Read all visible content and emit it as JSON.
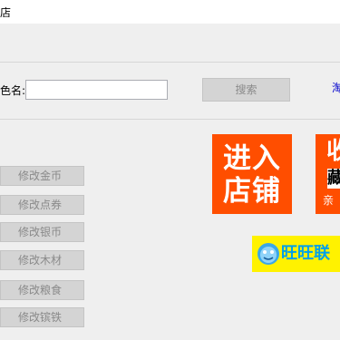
{
  "window": {
    "title": "店"
  },
  "search": {
    "label": "色名:",
    "input_value": "",
    "button_label": "搜索",
    "link_label": "淘"
  },
  "modify_buttons": [
    {
      "label": "修改金币"
    },
    {
      "label": "修改点券"
    },
    {
      "label": "修改银币"
    },
    {
      "label": "修改木材"
    },
    {
      "label": "修改粮食"
    },
    {
      "label": "修改镔铁"
    }
  ],
  "banners": {
    "enter_store": {
      "line1": "进入",
      "line2": "店铺",
      "color": "#ff4e00"
    },
    "favorite": {
      "char1": "收",
      "char2": "藏",
      "char3": "亲",
      "color": "#ff4e00"
    },
    "wangwang": {
      "label": "旺旺联",
      "bg_color": "#fff200",
      "text_color": "#00a0e9"
    }
  },
  "colors": {
    "background": "#efefef",
    "button_disabled_bg": "#d4d4d4",
    "button_disabled_text": "#8a8a8a",
    "link": "#0000cc"
  }
}
